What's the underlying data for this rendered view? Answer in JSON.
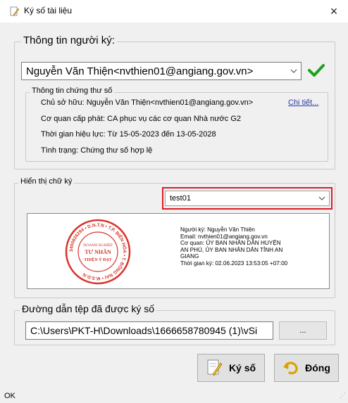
{
  "window": {
    "title": "Ký số tài liệu",
    "close_label": "×"
  },
  "signer_info": {
    "legend": "Thông tin người ký:",
    "selected_signer": "Nguyễn Văn Thiện<nvthien01@angiang.gov.vn>",
    "cert_legend": "Thông tin chứng thư số",
    "owner_line": "Chủ sở hữu: Nguyễn Văn Thiện<nvthien01@angiang.gov.vn>",
    "details_link": "Chi tiết...",
    "issuer_line": "Cơ quan cấp phát: CA phục vụ các cơ quan Nhà nước G2",
    "validity_line": "Thời gian hiệu lực: Từ 15-05-2023 đến 13-05-2028",
    "status_line": "Tình trạng: Chứng thư số hợp lệ"
  },
  "signature_display": {
    "legend": "Hiển thị chữ ký",
    "selected_template": "test01",
    "seal": {
      "line1": "DOANH NGHIỆP",
      "line2": "TƯ NHÂN",
      "line3": "THIỆN Ý ĐẠT",
      "ring_text": "3400826294 • D.N.T.N • T.P. BIÊN HÒA • T. ĐỒNG NAI • M.S.D.N"
    },
    "preview_lines": [
      "Người ký: Nguyễn Văn Thiện",
      "Email: nvthien01@angiang.gov.vn",
      "Cơ quan: ỦY BAN NHÂN DÂN HUYỆN",
      "AN PHÚ, ỦY BAN NHÂN DÂN TỈNH AN",
      "GIANG",
      "Thời gian ký: 02.06.2023 13:53:05 +07:00"
    ]
  },
  "output": {
    "legend": "Đường dẫn tệp đã được ký số",
    "path": "C:\\Users\\PKT-H\\Downloads\\1666658780945 (1)\\vSi",
    "browse_label": "..."
  },
  "actions": {
    "sign_label": "Ký số",
    "close_label": "Đóng"
  },
  "status": {
    "text": "OK"
  },
  "colors": {
    "highlight_red": "#e01b24",
    "check_green": "#1aa31a",
    "seal_red": "#d9342b"
  }
}
